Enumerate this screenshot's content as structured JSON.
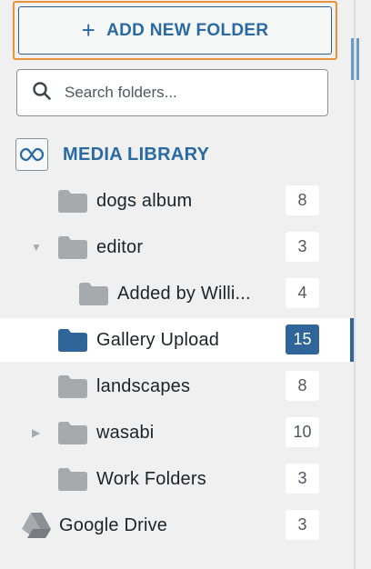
{
  "add_button": {
    "plus": "+",
    "label": "ADD NEW FOLDER"
  },
  "search": {
    "placeholder": "Search folders..."
  },
  "library": {
    "title": "MEDIA LIBRARY"
  },
  "folders": [
    {
      "label": "dogs album",
      "count": "8",
      "color": "#a7aaad",
      "arrow": ""
    },
    {
      "label": "editor",
      "count": "3",
      "color": "#a7aaad",
      "arrow": "▼"
    },
    {
      "label": "Added by Willi...",
      "count": "4",
      "color": "#a7aaad",
      "arrow": ""
    },
    {
      "label": "Gallery Upload",
      "count": "15",
      "color": "#2f6598",
      "arrow": ""
    },
    {
      "label": "landscapes",
      "count": "8",
      "color": "#a7aaad",
      "arrow": ""
    },
    {
      "label": "wasabi",
      "count": "10",
      "color": "#a7aaad",
      "arrow": "▶"
    },
    {
      "label": "Work Folders",
      "count": "3",
      "color": "#a7aaad",
      "arrow": ""
    }
  ],
  "google_drive": {
    "label": "Google Drive",
    "count": "3"
  }
}
